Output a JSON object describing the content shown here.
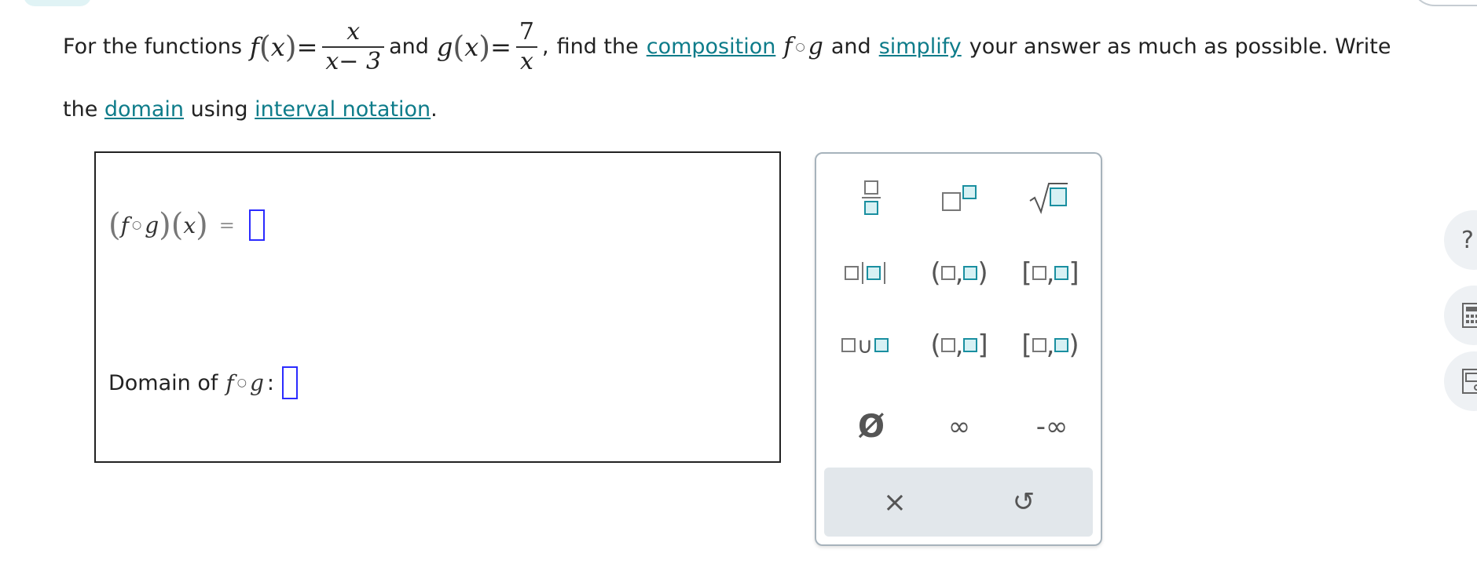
{
  "problem": {
    "intro": "For the functions",
    "f_name": "f",
    "x_var": "x",
    "equals": "=",
    "f_num": "x",
    "f_den": "x− 3",
    "and1": "and",
    "g_name": "g",
    "g_num": "7",
    "g_den": "x",
    "comma": ",",
    "find_the": "find the",
    "composition_link": "composition",
    "and2": "and",
    "simplify_link": "simplify",
    "rest1": "your answer as much as possible. Write",
    "the": "the",
    "domain_link": "domain",
    "using": "using",
    "interval_link": "interval notation",
    "period": "."
  },
  "answer": {
    "composition_label_f": "f",
    "composition_label_g": "g",
    "composition_label_x": "x",
    "equals": "=",
    "domain_label": "Domain of",
    "domain_f": "f",
    "domain_g": "g",
    "domain_colon": ":"
  },
  "palette": {
    "comma": ",",
    "infinity": "∞",
    "neg_infinity": "-∞",
    "empty_set": "Ø",
    "union": "∪",
    "clear": "×",
    "undo": "↺"
  },
  "side": {
    "help": "?"
  },
  "icons": [
    "fraction-icon",
    "superscript-icon",
    "sqrt-icon",
    "absolute-value-icon",
    "open-interval-icon",
    "closed-interval-icon",
    "union-icon",
    "half-open-right-closed-icon",
    "half-open-left-closed-icon",
    "empty-set-icon",
    "infinity-icon",
    "negative-infinity-icon",
    "clear-icon",
    "undo-icon",
    "help-icon",
    "calculator-icon",
    "reference-icon"
  ],
  "colors": {
    "link": "#0e7c8a",
    "input_border": "#2b2bff",
    "palette_teal": "#1a8fa0"
  }
}
